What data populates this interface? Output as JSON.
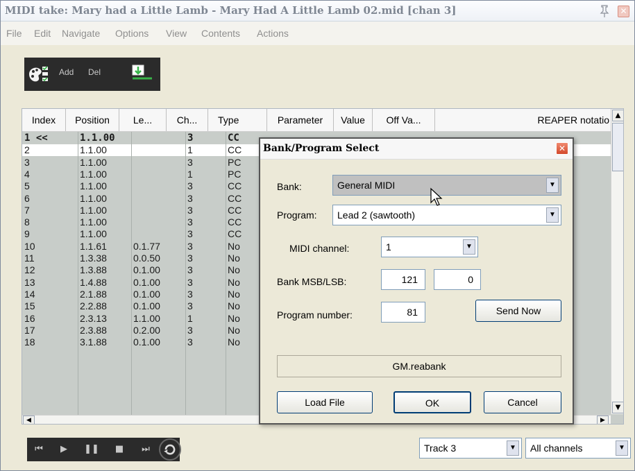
{
  "window": {
    "title": "MIDI take: Mary had a Little Lamb - Mary Had A Little Lamb 02.mid [chan 3]",
    "close_label": "✕"
  },
  "menu": [
    "File",
    "Edit",
    "Navigate",
    "Options",
    "View",
    "Contents",
    "Actions"
  ],
  "toolbar": {
    "add_label": "Add",
    "del_label": "Del"
  },
  "table": {
    "columns": [
      "Index",
      "Position",
      "Le...",
      "Ch...",
      "Type",
      "Parameter",
      "Value",
      "Off Va...",
      "REAPER notatio"
    ],
    "rows": [
      {
        "index": "1 <<",
        "position": "1.1.00",
        "length": "",
        "channel": "3",
        "type": "CC"
      },
      {
        "index": "2",
        "position": "1.1.00",
        "length": "",
        "channel": "1",
        "type": "CC"
      },
      {
        "index": "3",
        "position": "1.1.00",
        "length": "",
        "channel": "3",
        "type": "PC"
      },
      {
        "index": "4",
        "position": "1.1.00",
        "length": "",
        "channel": "1",
        "type": "PC"
      },
      {
        "index": "5",
        "position": "1.1.00",
        "length": "",
        "channel": "3",
        "type": "CC"
      },
      {
        "index": "6",
        "position": "1.1.00",
        "length": "",
        "channel": "3",
        "type": "CC"
      },
      {
        "index": "7",
        "position": "1.1.00",
        "length": "",
        "channel": "3",
        "type": "CC"
      },
      {
        "index": "8",
        "position": "1.1.00",
        "length": "",
        "channel": "3",
        "type": "CC"
      },
      {
        "index": "9",
        "position": "1.1.00",
        "length": "",
        "channel": "3",
        "type": "CC"
      },
      {
        "index": "10",
        "position": "1.1.61",
        "length": "0.1.77",
        "channel": "3",
        "type": "No"
      },
      {
        "index": "11",
        "position": "1.3.38",
        "length": "0.0.50",
        "channel": "3",
        "type": "No"
      },
      {
        "index": "12",
        "position": "1.3.88",
        "length": "0.1.00",
        "channel": "3",
        "type": "No"
      },
      {
        "index": "13",
        "position": "1.4.88",
        "length": "0.1.00",
        "channel": "3",
        "type": "No"
      },
      {
        "index": "14",
        "position": "2.1.88",
        "length": "0.1.00",
        "channel": "3",
        "type": "No"
      },
      {
        "index": "15",
        "position": "2.2.88",
        "length": "0.1.00",
        "channel": "3",
        "type": "No"
      },
      {
        "index": "16",
        "position": "2.3.13",
        "length": "1.1.00",
        "channel": "1",
        "type": "No"
      },
      {
        "index": "17",
        "position": "2.3.88",
        "length": "0.2.00",
        "channel": "3",
        "type": "No"
      },
      {
        "index": "18",
        "position": "3.1.88",
        "length": "0.1.00",
        "channel": "3",
        "type": "No"
      }
    ]
  },
  "bottom": {
    "track_select": "Track 3",
    "channel_select": "All channels"
  },
  "dialog": {
    "title": "Bank/Program Select",
    "close_label": "✕",
    "bank_label": "Bank:",
    "bank_value": "General MIDI",
    "program_label": "Program:",
    "program_value": "Lead 2 (sawtooth)",
    "midi_channel_label": "MIDI channel:",
    "midi_channel_value": "1",
    "bank_msb_lsb_label": "Bank MSB/LSB:",
    "bank_msb_value": "121",
    "bank_lsb_value": "0",
    "program_number_label": "Program number:",
    "program_number_value": "81",
    "send_now_label": "Send Now",
    "status_text": "GM.reabank",
    "load_file_label": "Load File",
    "ok_label": "OK",
    "cancel_label": "Cancel"
  },
  "colors": {
    "list_background": "#c8cdc9",
    "selected_row": "#ffffff",
    "toolbar_dark": "#2b2b2b",
    "dialog_close": "#d3492c"
  },
  "icons": [
    "pin-icon",
    "close-icon",
    "palette-icon",
    "insert-event-icon",
    "skip-start-icon",
    "play-icon",
    "pause-icon",
    "stop-icon",
    "skip-end-icon",
    "loop-icon",
    "chevron-down-icon",
    "mouse-cursor-icon"
  ]
}
